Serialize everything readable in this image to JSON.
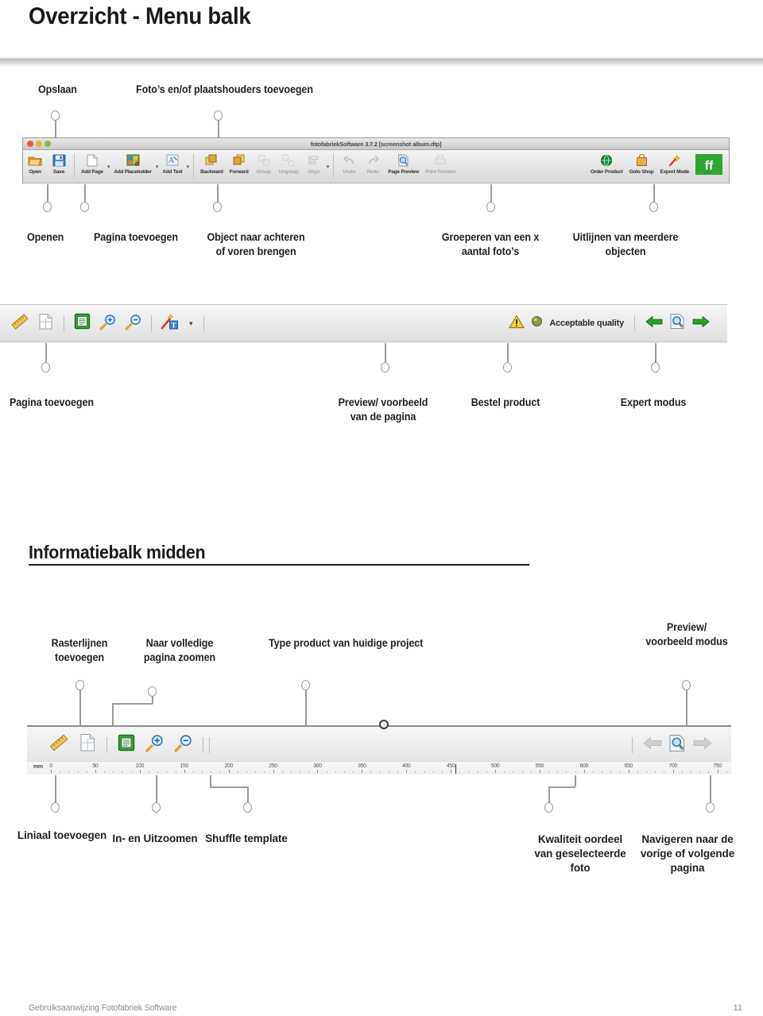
{
  "header": {
    "title": "Overzicht - Menu balk"
  },
  "section2": {
    "title": "Informatiebalk midden"
  },
  "footer": {
    "text": "Gebruiksaanwijzing Fotofabriek Software",
    "page_number": "11"
  },
  "toolbar_window": {
    "title": "fotofabriekSoftware 3.7.2 [screenshot album.dtp]",
    "buttons": [
      {
        "label": "Open",
        "icon": "open-folder-icon",
        "enabled": true
      },
      {
        "label": "Save",
        "icon": "floppy-disk-icon",
        "enabled": true
      },
      {
        "label": "Add Page",
        "icon": "blank-page-icon",
        "enabled": true
      },
      {
        "label": "Add Placeholder",
        "icon": "photo-frame-icon",
        "enabled": true
      },
      {
        "label": "Add Text",
        "icon": "text-box-icon",
        "enabled": true
      },
      {
        "label": "Backward",
        "icon": "send-backward-icon",
        "enabled": true
      },
      {
        "label": "Forward",
        "icon": "bring-forward-icon",
        "enabled": true
      },
      {
        "label": "Group",
        "icon": "group-icon",
        "enabled": false
      },
      {
        "label": "Ungroup",
        "icon": "ungroup-icon",
        "enabled": false
      },
      {
        "label": "Align",
        "icon": "align-icon",
        "enabled": false
      },
      {
        "label": "Undo",
        "icon": "undo-arrow-icon",
        "enabled": false
      },
      {
        "label": "Redo",
        "icon": "redo-arrow-icon",
        "enabled": false
      },
      {
        "label": "Page Preview",
        "icon": "page-preview-icon",
        "enabled": true
      },
      {
        "label": "Print Preview",
        "icon": "print-preview-icon",
        "enabled": false
      },
      {
        "label": "Order Product",
        "icon": "globe-icon",
        "enabled": true
      },
      {
        "label": "Goto Shop",
        "icon": "shopping-bag-icon",
        "enabled": true
      },
      {
        "label": "Export Mode",
        "icon": "magic-wand-icon",
        "enabled": true
      },
      {
        "label": "ff",
        "icon": "ff-logo-icon",
        "enabled": true
      }
    ]
  },
  "callouts_top": [
    {
      "label": "Opslaan"
    },
    {
      "label": "Foto’s en/of plaatshouders toevoegen"
    }
  ],
  "callouts_top_below": [
    {
      "label": "Openen"
    },
    {
      "label": "Pagina toevoegen"
    },
    {
      "label": "Object naar achteren of voren brengen"
    },
    {
      "label": "Groeperen van een x aantal foto’s"
    },
    {
      "label": "Uitlijnen van meerdere objecten"
    }
  ],
  "infobar_top": {
    "left_icons": [
      "ruler-icon",
      "page-layout-icon",
      "green-book-icon",
      "zoom-in-icon",
      "zoom-out-icon",
      "magic-text-icon",
      "chevron-down-icon"
    ],
    "quality_label": "Acceptable quality",
    "right_icons": [
      "warning-triangle-icon",
      "quality-dot-icon",
      "arrow-left-icon",
      "page-preview-icon",
      "arrow-right-icon"
    ],
    "quality_dot_color": "#8d9b3f",
    "arrow_color": "#2f9e2f"
  },
  "callouts_infobar": [
    {
      "label": "Pagina toevoegen"
    },
    {
      "label": "Preview/ voorbeeld van de pagina"
    },
    {
      "label": "Bestel product"
    },
    {
      "label": "Expert modus"
    }
  ],
  "callouts_mid_above": [
    {
      "label": "Rasterlijnen toevoegen"
    },
    {
      "label": "Naar volledige pagina zoomen"
    },
    {
      "label": "Type product van huidige project"
    },
    {
      "label": "Preview/ voorbeeld modus"
    }
  ],
  "callouts_mid_below": [
    {
      "label": "Liniaal toevoegen"
    },
    {
      "label": "In- en Uitzoomen"
    },
    {
      "label": "Shuffle template"
    },
    {
      "label": "Kwaliteit oordeel van geselecteerde foto"
    },
    {
      "label": "Navigeren naar de vorige of volgende pagina"
    }
  ],
  "infobar_mid": {
    "left_icons": [
      "ruler-icon",
      "page-layout-icon",
      "green-book-icon",
      "zoom-in-icon",
      "zoom-out-icon"
    ],
    "right_icons": [
      "arrow-left-icon",
      "page-preview-icon",
      "arrow-right-icon"
    ],
    "ruler": {
      "unit": "mm",
      "ticks": [
        0,
        50,
        100,
        150,
        200,
        250,
        300,
        350,
        400,
        450,
        500,
        550,
        600,
        650,
        700,
        750
      ],
      "caret_at": 455
    }
  }
}
